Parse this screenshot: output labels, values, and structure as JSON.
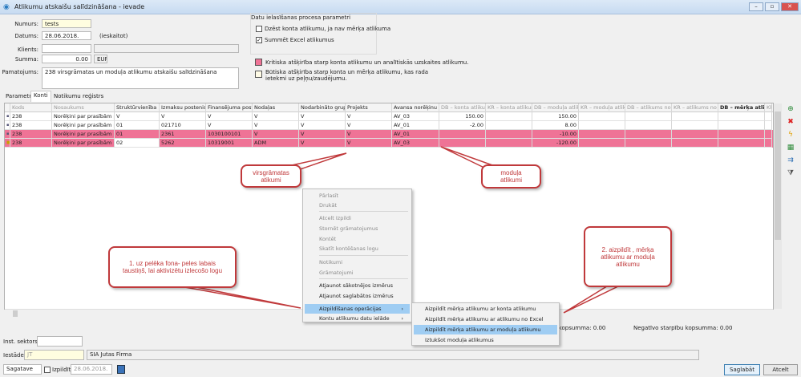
{
  "window": {
    "title": "Atlikumu atskaišu salīdzināšana - ievade",
    "minimize": "–",
    "restore": "▫",
    "close": "✕"
  },
  "form": {
    "numurs_label": "Numurs:",
    "numurs": "tests",
    "datums_label": "Datums:",
    "datums": "28.06.2018.",
    "ieskaitot": "(ieskaitot)",
    "klients_label": "Klients:",
    "klients": "",
    "klients_name": "",
    "summa_label": "Summa:",
    "summa": "0.00",
    "currency": "EUR",
    "pamatojums_label": "Pamatojums:",
    "pamatojums": "238 virsgrāmatas un moduļa atlikumu atskaišu salīdzināšana"
  },
  "params": {
    "title": "Datu ielasīšanas procesa parametri",
    "options": [
      {
        "label": "Dzēst konta atlikumu, ja nav mērķa atlikuma",
        "checked": false
      },
      {
        "label": "Summēt Excel atlikumus",
        "checked": true
      }
    ]
  },
  "legend": [
    {
      "color": "#ef7396",
      "text": "Kritiska atšķirība starp konta atlikumu un analītiskās uzskaites atlikumu."
    },
    {
      "color": "#fffbe6",
      "text": "Būtiska atšķirība starp konta un mērķa atlikumu, kas rada ietekmi uz peļņu/zaudējumu."
    }
  ],
  "tabs": [
    {
      "label": "Parametri",
      "active": false
    },
    {
      "label": "Konti",
      "active": true
    },
    {
      "label": "Notikumu reģistrs",
      "active": false
    }
  ],
  "grid": {
    "columns": [
      "Kods",
      "Nosaukums",
      "Struktūrvienība",
      "Izmaksu postenis",
      "Finansējuma post...",
      "Nodaļas",
      "Nodarbināto grupas",
      "Projekts",
      "Avansa norēķinu ...",
      "DB – konta atlikums",
      "KR – konta atlikums",
      "DB – moduļa atlik...",
      "KR – moduļa atlik...",
      "DB – atlikums no ...",
      "KR – atlikums no ...",
      "DB – mērķa atlikums",
      "KR – ..."
    ],
    "rows": [
      {
        "highlight": false,
        "cells": [
          "238",
          "Norēķini par prasībām pr...",
          "V",
          "V",
          "V",
          "V",
          "V",
          "V",
          "AV_03",
          "150.00",
          "",
          "150.00",
          "",
          "",
          "",
          "",
          ""
        ]
      },
      {
        "highlight": false,
        "cells": [
          "238",
          "Norēķini par prasībām pr...",
          "01",
          "021710",
          "V",
          "V",
          "V",
          "V",
          "AV_01",
          "-2.00",
          "",
          "8.00",
          "",
          "",
          "",
          "",
          ""
        ]
      },
      {
        "highlight": true,
        "cells": [
          "238",
          "Norēķini par prasībām pr...",
          "01",
          "2361",
          "1030100101",
          "V",
          "V",
          "V",
          "AV_01",
          "",
          "",
          "-10.00",
          "",
          "",
          "",
          "",
          ""
        ]
      },
      {
        "highlight": true,
        "cells": [
          "238",
          "Norēķini par prasībām pr...",
          "02",
          "5262",
          "10319001",
          "ADM",
          "V",
          "V",
          "AV_03",
          "",
          "",
          "-120.00",
          "",
          "",
          "",
          "",
          ""
        ]
      }
    ]
  },
  "toolbar_icons": [
    "add-icon",
    "delete-icon",
    "lightning-icon",
    "excel-icon",
    "export-icon",
    "filter-icon"
  ],
  "context_menu": {
    "items": [
      {
        "label": "Pārlasīt",
        "enabled": false
      },
      {
        "label": "Drukāt",
        "enabled": false
      },
      {
        "label": "Atcelt Izpildi",
        "enabled": false
      },
      {
        "label": "Stornēt grāmatojumus",
        "enabled": false
      },
      {
        "label": "Kontēt",
        "enabled": false
      },
      {
        "label": "Skatīt kontēšanas logu",
        "enabled": false
      },
      {
        "label": "Notikumi",
        "enabled": false
      },
      {
        "label": "Grāmatojumi",
        "enabled": false
      },
      {
        "label": "Atjaunot sākotnējos izmērus",
        "enabled": true
      },
      {
        "label": "Atjaunot saglabātos izmērus",
        "enabled": true
      },
      {
        "label": "Aizpildīšanas operācijas",
        "enabled": true,
        "highlighted": true
      },
      {
        "label": "Kontu atlikumu datu ielāde",
        "enabled": true
      }
    ],
    "submenu": [
      {
        "label": "Aizpildīt mērķa atlikumu ar konta atlikumu"
      },
      {
        "label": "Aizpildīt mērķa atlikumu ar atlikumu no Excel"
      },
      {
        "label": "Aizpildīt mērķa atlikumu ar moduļa atlikumu",
        "highlighted": true
      },
      {
        "label": "Iztukšot moduļa atlikumus"
      }
    ]
  },
  "totals": {
    "positive": "u kopsumma:",
    "positive_value": "0.00",
    "negative": "Negatīvo starpību kopsumma:",
    "negative_value": "0.00"
  },
  "bottom": {
    "inst_label": "Inst. sektors:",
    "inst": "",
    "iestade_label": "Iestāde:",
    "iestade_code": "JT",
    "iestade_name": "SIA Jutas Firma",
    "status": "Sagatave",
    "izpildit_label": "Izpildīt:",
    "izpildit_date": "28.06.2018.",
    "save": "Saglabāt",
    "cancel": "Atcelt"
  },
  "callouts": {
    "virsgramatas": "virsgrāmatas atikumi",
    "modula": "moduļa atlikumi",
    "step1": "1. uz pelēka fona- peles labais taustiņš, lai aktivizētu izlecošo logu",
    "step2": "2. aizpildīt , mērķa atlikumu ar moduļa atlikumu"
  },
  "colors": {
    "critical": "#ef7396",
    "annotation": "#c0393b",
    "highlight": "#9fcdf3"
  }
}
